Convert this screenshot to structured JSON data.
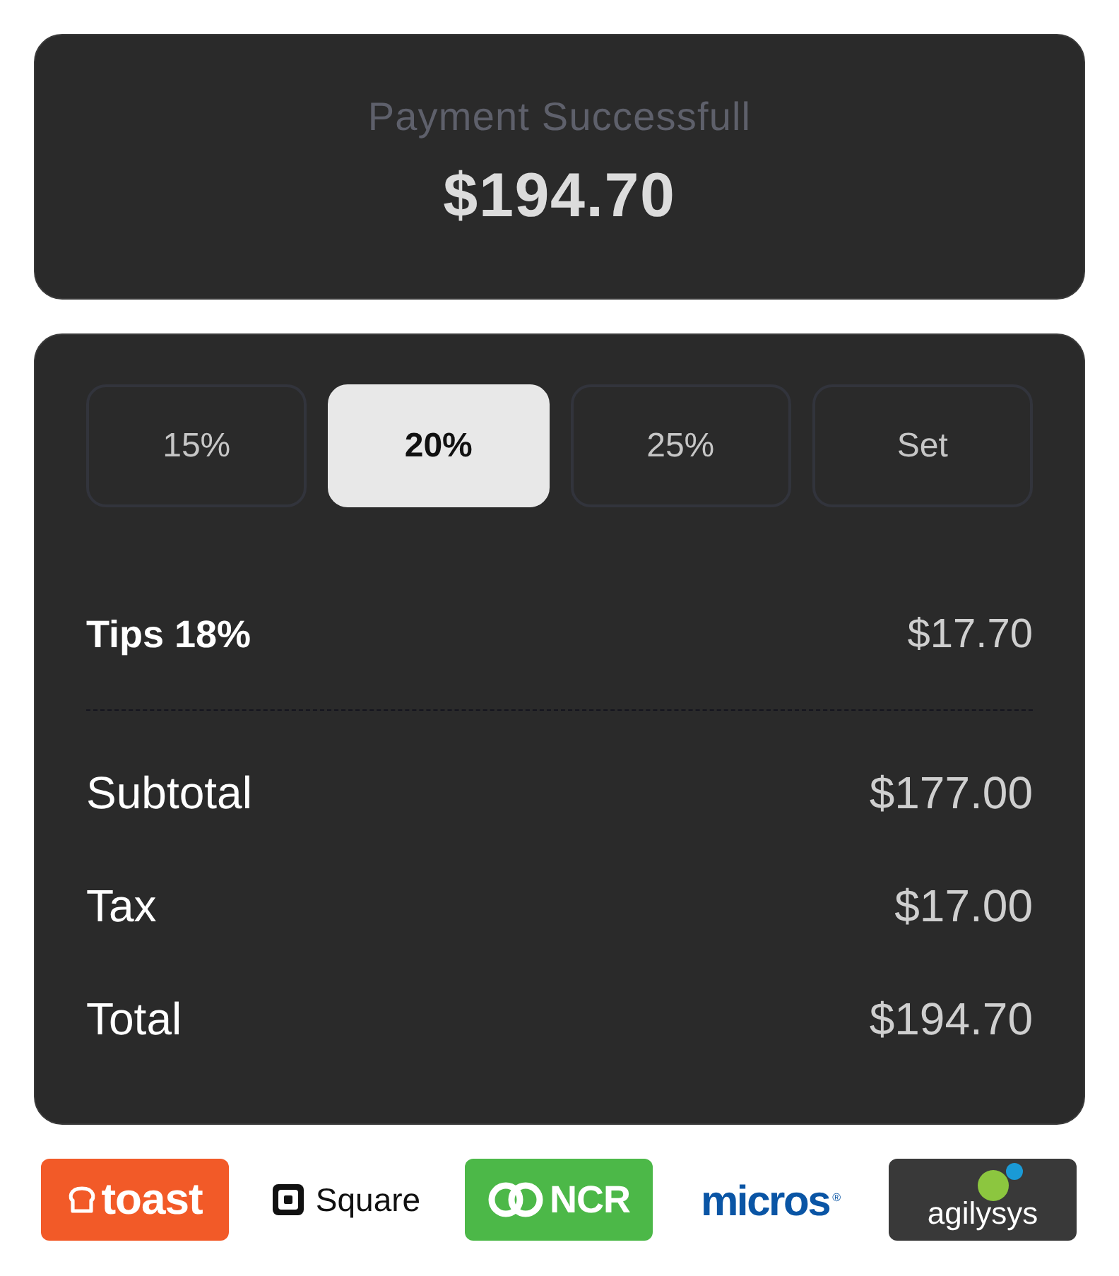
{
  "header": {
    "title": "Payment Successfull",
    "amount": "$194.70"
  },
  "tip_options": [
    {
      "label": "15%",
      "selected": false
    },
    {
      "label": "20%",
      "selected": true
    },
    {
      "label": "25%",
      "selected": false
    },
    {
      "label": "Set",
      "selected": false
    }
  ],
  "tip": {
    "label": "Tips 18%",
    "amount": "$17.70"
  },
  "summary": [
    {
      "label": "Subtotal",
      "amount": "$177.00"
    },
    {
      "label": "Tax",
      "amount": "$17.00"
    },
    {
      "label": "Total",
      "amount": "$194.70"
    }
  ],
  "partner_logos": [
    {
      "kind": "bread",
      "text": "toast",
      "color": "#f25a28"
    },
    {
      "kind": "boxed",
      "text": "Square",
      "color": "#111111"
    },
    {
      "kind": "rings",
      "text": "NCR",
      "color": "#4cb848"
    },
    {
      "kind": "wordmark",
      "text": "micros$^{®}$",
      "color": "#0a55a5"
    },
    {
      "kind": "dots",
      "text": "agilysys",
      "color": "#393939"
    }
  ]
}
